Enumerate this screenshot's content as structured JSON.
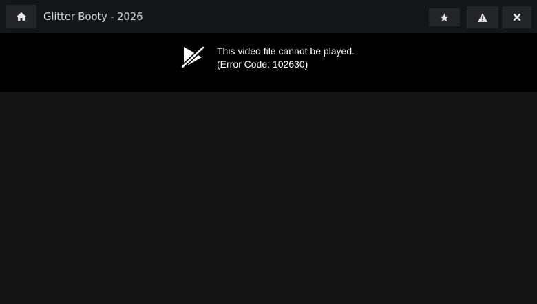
{
  "header": {
    "title": "Glitter Booty - 2026",
    "buttons": {
      "home": "home-icon",
      "favorite": "star-icon",
      "report": "warning-icon",
      "close": "close-icon"
    }
  },
  "player": {
    "error_message": "This video file cannot be played.",
    "error_code": "(Error Code: 102630)",
    "icon": "video-error-icon"
  },
  "colors": {
    "topbar": "#12161a",
    "button": "#22262a",
    "player_background": "#000000",
    "page_background": "#141414",
    "title_text": "#d4d8dc"
  }
}
